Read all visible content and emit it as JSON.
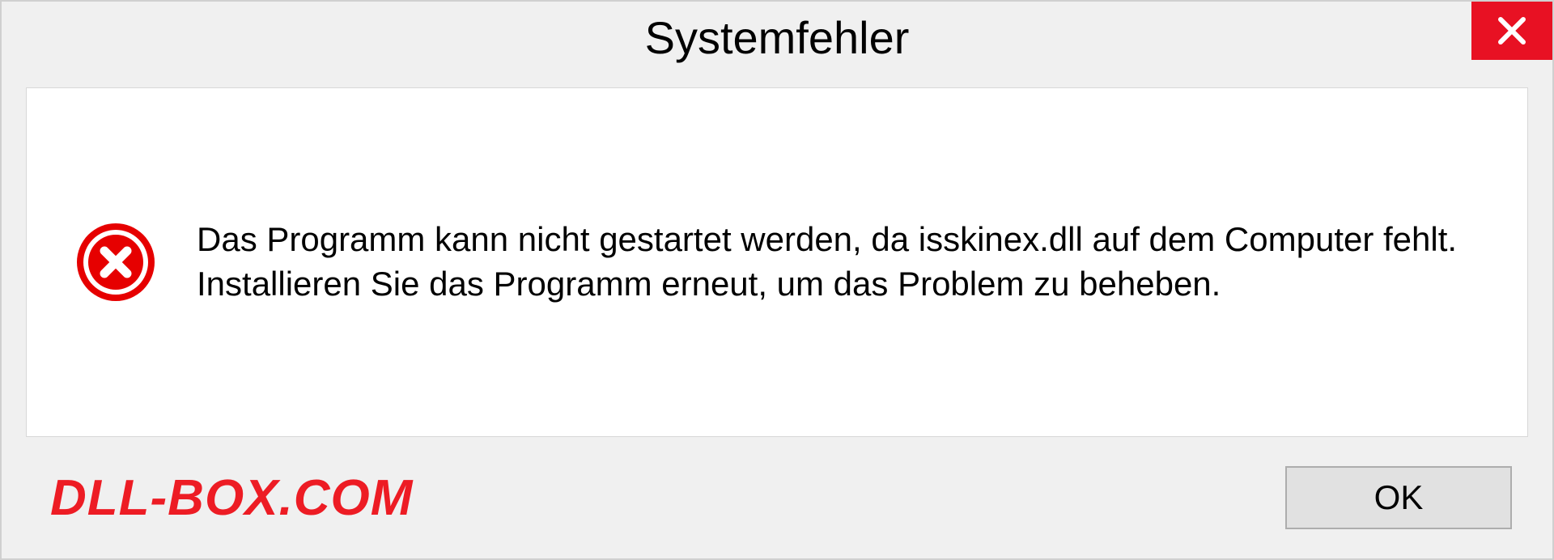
{
  "titlebar": {
    "title": "Systemfehler"
  },
  "content": {
    "message": "Das Programm kann nicht gestartet werden, da isskinex.dll auf dem Computer fehlt. Installieren Sie das Programm erneut, um das Problem zu beheben."
  },
  "footer": {
    "watermark": "DLL-BOX.COM",
    "ok_label": "OK"
  },
  "icons": {
    "close": "close-icon",
    "error": "error-circle-icon"
  },
  "colors": {
    "close_bg": "#e81123",
    "error_red": "#e60000",
    "watermark": "#ed1c24"
  }
}
